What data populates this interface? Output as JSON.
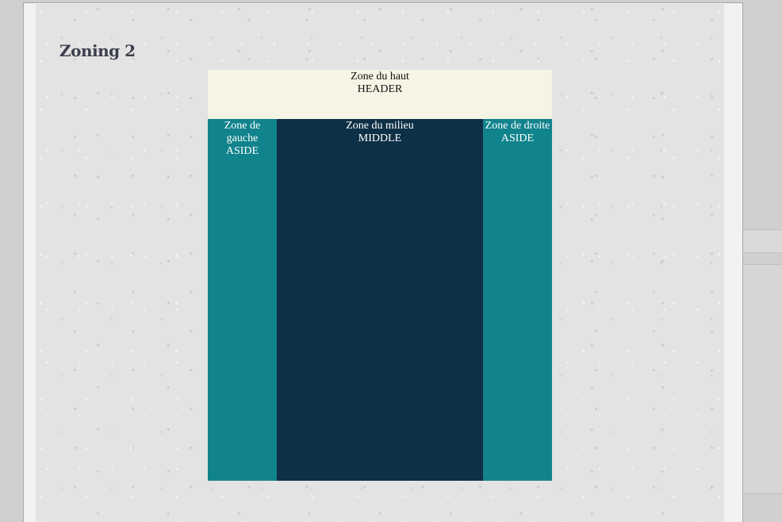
{
  "page": {
    "title": "Zoning 2"
  },
  "header": {
    "line1": "Zone du haut",
    "line2": "HEADER"
  },
  "left_aside": {
    "line1": "Zone de",
    "line2": "gauche",
    "line3": "ASIDE"
  },
  "middle": {
    "line1": "Zone du milieu",
    "line2": "MIDDLE"
  },
  "right_aside": {
    "line1": "Zone de droite",
    "line2": "ASIDE"
  },
  "colors": {
    "header_bg": "#f6f4e4",
    "aside_bg": "#11838c",
    "middle_bg": "#0e3046",
    "page_bg": "#e3e3e3"
  }
}
